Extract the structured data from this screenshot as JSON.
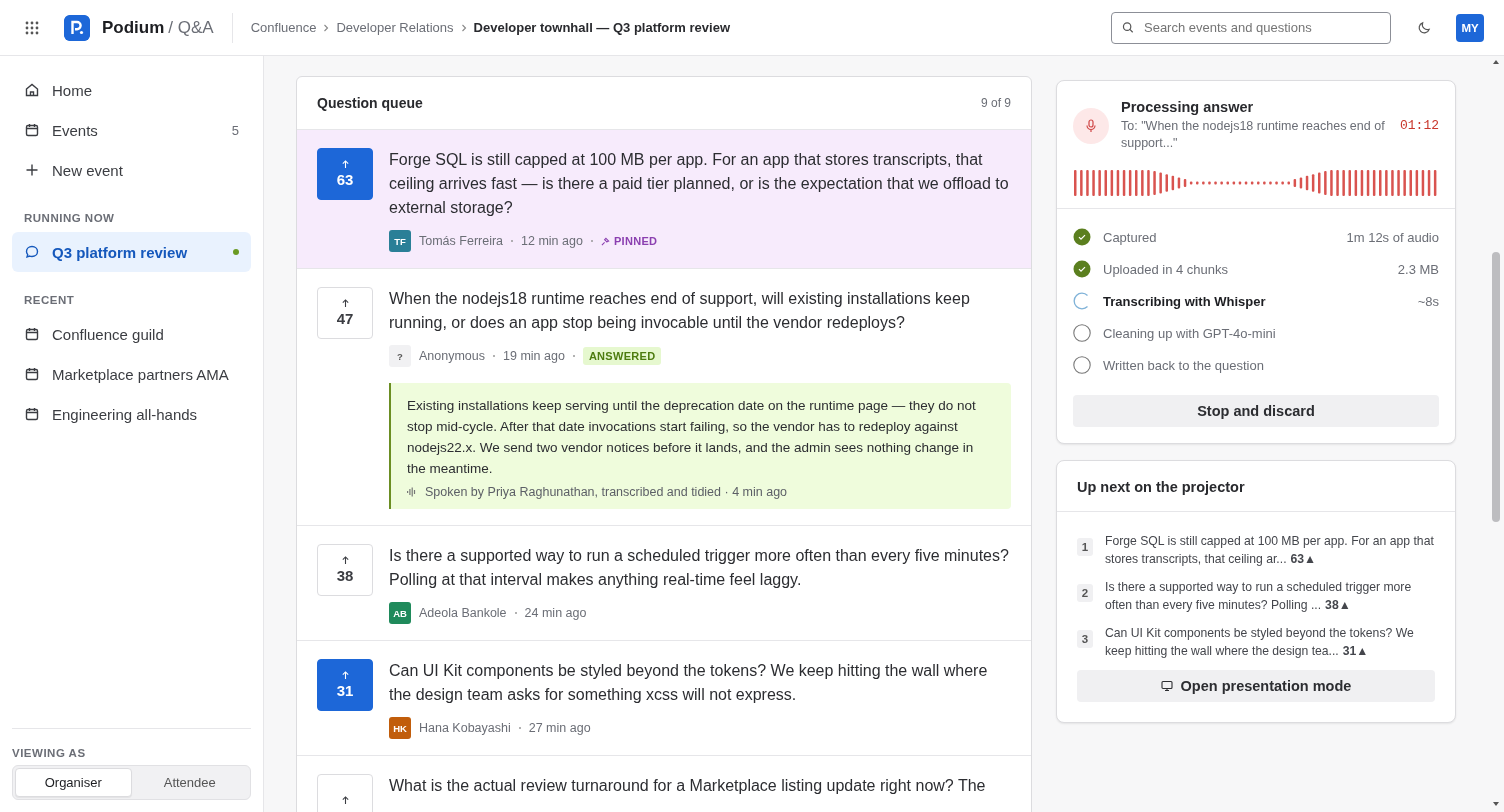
{
  "header": {
    "brand": "Podium",
    "section": "/ Q&A",
    "breadcrumbs": [
      {
        "label": "Confluence",
        "current": false
      },
      {
        "label": "Developer Relations",
        "current": false
      },
      {
        "label": "Developer townhall — Q3 platform review",
        "current": true
      }
    ],
    "search": {
      "placeholder": "Search events and questions"
    },
    "avatar": "MY"
  },
  "sidebar": {
    "items": [
      {
        "kind": "home",
        "label": "Home"
      },
      {
        "kind": "calendar",
        "label": "Events",
        "count": "5"
      },
      {
        "kind": "plus",
        "label": "New event"
      }
    ],
    "sections": [
      {
        "title": "RUNNING NOW",
        "items": [
          {
            "kind": "chat",
            "label": "Q3 platform review",
            "selected": true,
            "live": true
          }
        ]
      },
      {
        "title": "RECENT",
        "items": [
          {
            "kind": "calendar",
            "label": "Confluence guild",
            "selected": false,
            "live": false
          },
          {
            "kind": "calendar",
            "label": "Marketplace partners AMA",
            "selected": false,
            "live": false
          },
          {
            "kind": "calendar",
            "label": "Engineering all-hands",
            "selected": false,
            "live": false
          }
        ]
      }
    ],
    "viewing_as": {
      "title": "VIEWING AS",
      "options": [
        {
          "label": "Organiser",
          "selected": true
        },
        {
          "label": "Attendee",
          "selected": false
        }
      ]
    }
  },
  "queue": {
    "title": "Question queue",
    "count": "9 of 9",
    "questions": [
      {
        "votes": "63",
        "voted": true,
        "pinned": true,
        "text": "Forge SQL is still capped at 100 MB per app. For an app that stores transcripts, that ceiling arrives fast — is there a paid tier planned, or is the expectation that we offload to external storage?",
        "initials": "TF",
        "color": "#2a7f97",
        "author": "Tomás Ferreira",
        "time": "12 min ago",
        "badge": "PINNED"
      },
      {
        "votes": "47",
        "voted": false,
        "pinned": false,
        "text": "When the nodejs18 runtime reaches end of support, will existing installations keep running, or does an app stop being invocable until the vendor redeploys?",
        "initials": "?",
        "color": "#f1f1f3",
        "author": "Anonymous",
        "time": "19 min ago",
        "badge": "ANSWERED",
        "answer": {
          "text": "Existing installations keep serving until the deprecation date on the runtime page — they do not stop mid-cycle. After that date invocations start failing, so the vendor has to redeploy against nodejs22.x. We send two vendor notices before it lands, and the admin sees nothing change in the meantime.",
          "credit": "Spoken by Priya Raghunathan, transcribed and tidied · 4 min ago"
        }
      },
      {
        "votes": "38",
        "voted": false,
        "pinned": false,
        "text": "Is there a supported way to run a scheduled trigger more often than every five minutes? Polling at that interval makes anything real-time feel laggy.",
        "initials": "AB",
        "color": "#1f8a5b",
        "author": "Adeola Bankole",
        "time": "24 min ago"
      },
      {
        "votes": "31",
        "voted": true,
        "pinned": false,
        "text": "Can UI Kit components be styled beyond the tokens? We keep hitting the wall where the design team asks for something xcss will not express.",
        "initials": "HK",
        "color": "#c15d0b",
        "author": "Hana Kobayashi",
        "time": "27 min ago"
      },
      {
        "voted": false,
        "pinned": false,
        "text": "What is the actual review turnaround for a Marketplace listing update right now? The"
      }
    ]
  },
  "processing": {
    "title": "Processing answer",
    "subtitle": "To: \"When the nodejs18 runtime reaches end of support...\"",
    "timer": "01:12",
    "steps": [
      {
        "label": "Captured",
        "detail": "1m 12s of audio",
        "done": true,
        "active": false
      },
      {
        "label": "Uploaded in 4 chunks",
        "detail": "2.3 MB",
        "done": true,
        "active": false
      },
      {
        "label": "Transcribing with Whisper",
        "detail": "~8s",
        "done": false,
        "active": true
      },
      {
        "label": "Cleaning up with GPT-4o-mini",
        "done": false,
        "active": false
      },
      {
        "label": "Written back to the question",
        "done": false,
        "active": false
      }
    ],
    "button": "Stop and discard"
  },
  "up_next": {
    "title": "Up next on the projector",
    "items": [
      {
        "number": "1",
        "text": "Forge SQL is still capped at 100 MB per app. For an app that stores transcripts, that ceiling ar...",
        "votes": "63▲"
      },
      {
        "number": "2",
        "text": "Is there a supported way to run a scheduled trigger more often than every five minutes? Polling ...",
        "votes": "38▲"
      },
      {
        "number": "3",
        "text": "Can UI Kit components be styled beyond the tokens? We keep hitting the wall where the design tea...",
        "votes": "31▲"
      }
    ],
    "button": "Open presentation mode"
  }
}
